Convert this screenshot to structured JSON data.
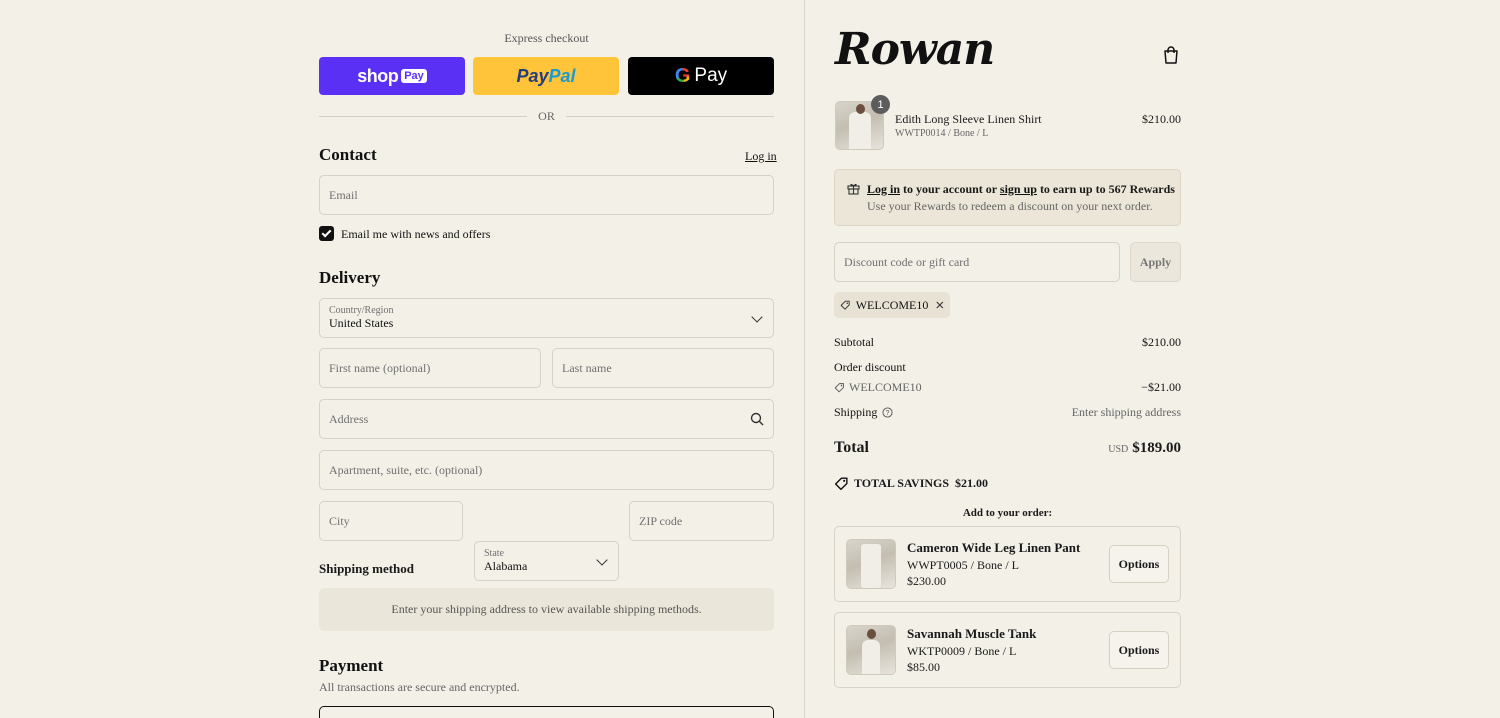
{
  "express": {
    "title": "Express checkout",
    "shop_label": "shop",
    "shop_chip": "Pay",
    "paypal_part1": "Pay",
    "paypal_part2": "Pal",
    "gpay_g": "G",
    "gpay_label": "Pay",
    "or": "OR"
  },
  "contact": {
    "heading": "Contact",
    "login_link": "Log in",
    "email_placeholder": "Email",
    "newsletter_label": "Email me with news and offers"
  },
  "delivery": {
    "heading": "Delivery",
    "country_label": "Country/Region",
    "country_value": "United States",
    "first_name_placeholder": "First name (optional)",
    "last_name_placeholder": "Last name",
    "address_placeholder": "Address",
    "apartment_placeholder": "Apartment, suite, etc. (optional)",
    "city_placeholder": "City",
    "state_label": "State",
    "state_value": "Alabama",
    "zip_placeholder": "ZIP code"
  },
  "shipping_method": {
    "heading": "Shipping method",
    "info": "Enter your shipping address to view available shipping methods."
  },
  "payment": {
    "heading": "Payment",
    "subtitle": "All transactions are secure and encrypted."
  },
  "brand": {
    "logo": "Rowan"
  },
  "cart": {
    "item": {
      "quantity": "1",
      "name": "Edith Long Sleeve Linen Shirt",
      "variant": "WWTP0014 / Bone / L",
      "price": "$210.00"
    }
  },
  "rewards": {
    "login": "Log in",
    "text1": "to your account or",
    "signup": "sign up",
    "text2": "to earn up to 567 Rewards",
    "subtext": "Use your Rewards to redeem a discount on your next order."
  },
  "discount": {
    "placeholder": "Discount code or gift card",
    "apply_label": "Apply",
    "applied_code": "WELCOME10"
  },
  "summary": {
    "subtotal_label": "Subtotal",
    "subtotal_value": "$210.00",
    "order_discount_label": "Order discount",
    "discount_code": "WELCOME10",
    "discount_value": "−$21.00",
    "shipping_label": "Shipping",
    "shipping_value": "Enter shipping address",
    "total_label": "Total",
    "currency": "USD",
    "total_value": "$189.00",
    "savings_label": "TOTAL SAVINGS",
    "savings_value": "$21.00"
  },
  "upsell": {
    "heading": "Add to your order:",
    "items": [
      {
        "name": "Cameron Wide Leg Linen Pant",
        "variant": "WWPT0005 / Bone / L",
        "price": "$230.00",
        "button": "Options"
      },
      {
        "name": "Savannah Muscle Tank",
        "variant": "WKTP0009 / Bone / L",
        "price": "$85.00",
        "button": "Options"
      }
    ]
  },
  "colors": {
    "background": "#f3f0e8",
    "shop_pay": "#5a31f4",
    "paypal": "#ffc439",
    "gpay": "#000000"
  }
}
